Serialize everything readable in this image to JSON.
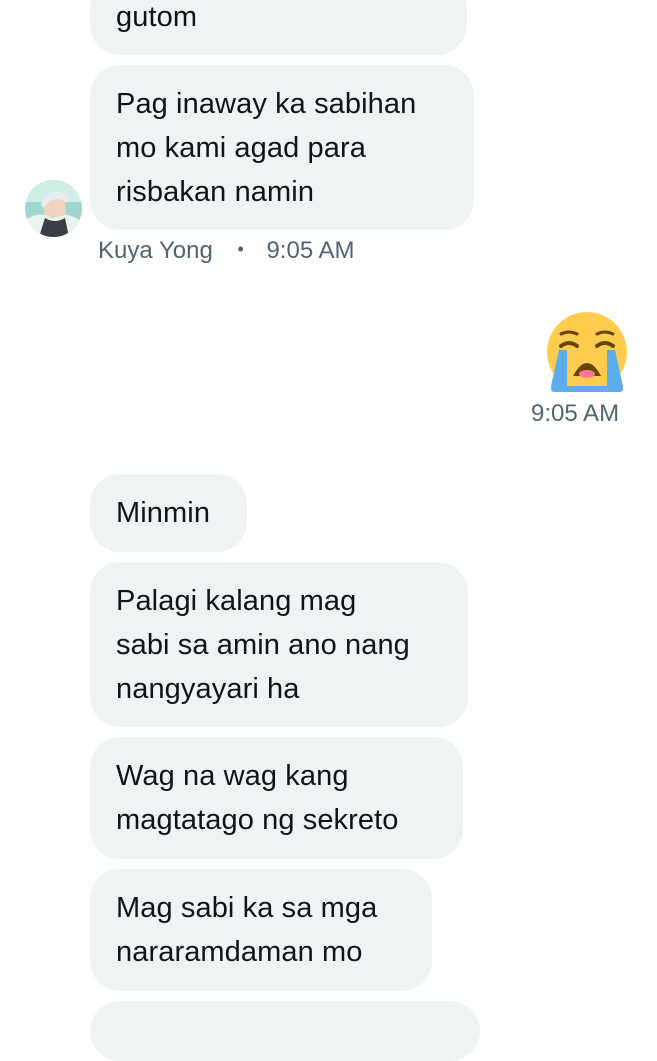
{
  "conversation": {
    "messages": [
      {
        "text": "gutom"
      },
      {
        "text": "Pag inaway ka sabihan\nmo kami agad para\nrisbakan namin"
      },
      {
        "text": "Minmin"
      },
      {
        "text": "Palagi kalang mag\nsabi sa amin ano nang\nnangyayari ha"
      },
      {
        "text": "Wag na wag kang\nmagtatago ng sekreto"
      },
      {
        "text": "Mag sabi ka sa mga\nnararamdaman mo"
      },
      {
        "text": ""
      }
    ],
    "incoming_meta": {
      "sender": "Kuya Yong",
      "separator": "•",
      "time": "9:05 AM"
    },
    "outgoing": {
      "emoji_name": "loudly-crying-face-icon",
      "time": "9:05 AM"
    }
  },
  "colors": {
    "incoming_bubble": "#eff3f4",
    "text": "#0f1419",
    "meta": "#536471",
    "emoji_face": "#ffcc4d",
    "emoji_tears": "#5dadec"
  }
}
